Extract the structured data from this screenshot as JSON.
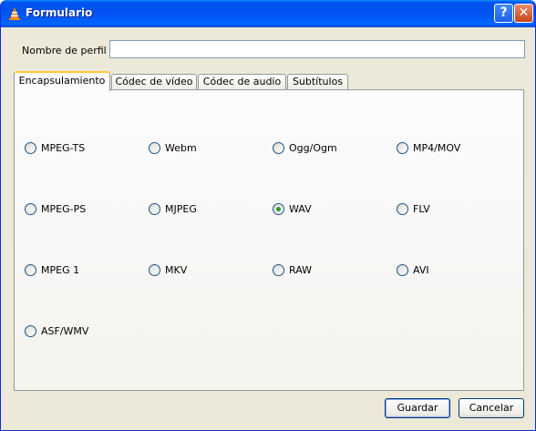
{
  "window": {
    "title": "Formulario",
    "help_label": "?",
    "close_label": "✕"
  },
  "profile": {
    "label": "Nombre de perfil",
    "value": ""
  },
  "tabs": [
    {
      "label": "Encapsulamiento",
      "active": true
    },
    {
      "label": "Códec de vídeo",
      "active": false
    },
    {
      "label": "Códec de audio",
      "active": false
    },
    {
      "label": "Subtítulos",
      "active": false
    }
  ],
  "encapsulation": {
    "selected": "WAV",
    "options": [
      "MPEG-TS",
      "Webm",
      "Ogg/Ogm",
      "MP4/MOV",
      "MPEG-PS",
      "MJPEG",
      "WAV",
      "FLV",
      "MPEG 1",
      "MKV",
      "RAW",
      "AVI",
      "ASF/WMV"
    ]
  },
  "buttons": {
    "save": "Guardar",
    "cancel": "Cancelar"
  },
  "colors": {
    "titlebar": "#0055ea",
    "accent_tab": "#ffc83c",
    "radio_selected": "#21a121"
  }
}
